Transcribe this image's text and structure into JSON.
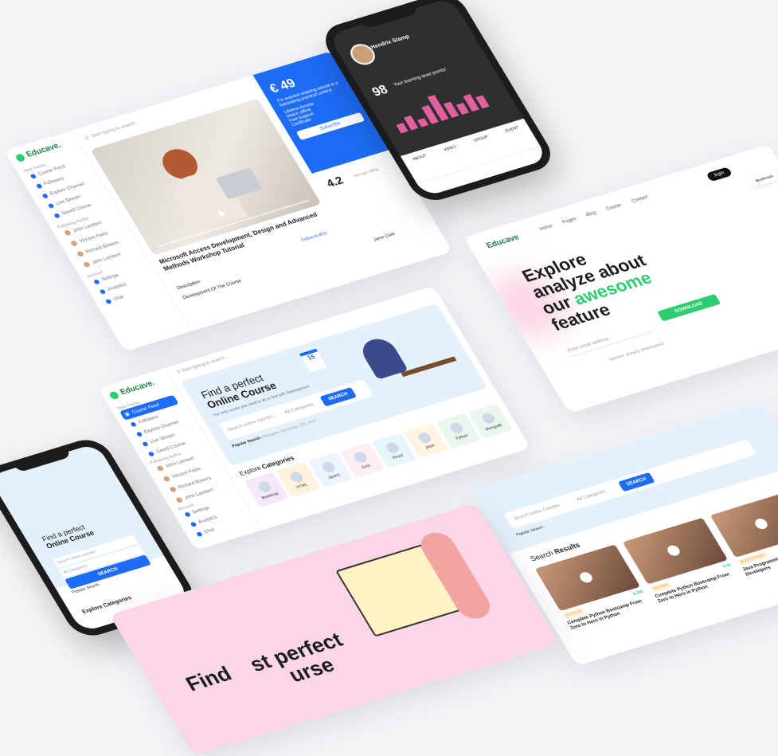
{
  "colors": {
    "accent": "#1d6cf5",
    "green": "#2ecc71",
    "pink": "#fbd6e6",
    "lightblue": "#e3f1fb",
    "dark": "#2b2b2b"
  },
  "course_page": {
    "brand": "Educave.",
    "search_placeholder": "Start typing to search...",
    "sidebar": {
      "section": "New Feeds",
      "items": [
        "Course Feed",
        "Followers",
        "Explore Channel",
        "Live Stream",
        "Saved Course"
      ],
      "following": "Following Author",
      "authors": [
        "John Lambert",
        "Vincent Parks",
        "Richard Bowers",
        "John Lambert"
      ],
      "account": "Account",
      "account_items": [
        "Settings",
        "Analytics",
        "Chat"
      ]
    },
    "price": "€ 49",
    "price_note": "For express ordering tutorial in a fascinating practical context",
    "features": [
      "Lifetime Access",
      "Watch offline",
      "Fast Support",
      "Certificate"
    ],
    "buy": "Subscribe",
    "course_title": "Microsoft Access Development, Design and Advanced Methods Workshop Tutorial",
    "rating": "4.2",
    "rating_label": "Average rating",
    "reviewer": "Jame Clark",
    "follow": "Follow Author",
    "tab_desc": "Description",
    "tab_more": "Development Of The Course"
  },
  "profile_phone": {
    "name": "Hendrix Stamp",
    "score": "98",
    "score_label": "Your learning level points!",
    "bars": [
      0.3,
      0.45,
      0.25,
      0.6,
      0.85,
      0.5,
      0.35,
      0.55,
      0.4
    ],
    "tabs": [
      "ABOUT",
      "VIDEO",
      "GROUP",
      "EVENT"
    ]
  },
  "main_page": {
    "brand": "Educave.",
    "search_placeholder": "Start typing to search...",
    "sidebar": {
      "section": "New Feeds",
      "items": [
        "Course Feed",
        "Followers",
        "Explore Channel",
        "Live Stream",
        "Saved Course"
      ],
      "following": "Following Author",
      "authors": [
        "John Lambert",
        "Vincent Parks",
        "Richard Bowers",
        "John Lambert"
      ],
      "account": "Account",
      "account_items": [
        "Settings",
        "Analytics",
        "Chat"
      ]
    },
    "hero_title_1": "Find a perfect",
    "hero_title_2": "Online Course",
    "hero_sub": "For only course you need to do to find with Development",
    "search_input": "Search online courses..",
    "category_select": "All Categories",
    "search_button": "SEARCH",
    "popular": "Popular Search :",
    "popular_items": "Designer, Developer, iOS, PHP",
    "explore_1": "Explore",
    "explore_2": "Categories",
    "categories": [
      {
        "name": "Bootstrap",
        "color": "#f3e9fb"
      },
      {
        "name": "HTML",
        "color": "#fff3e0"
      },
      {
        "name": "Jquery",
        "color": "#eef4ff"
      },
      {
        "name": "Sass",
        "color": "#ffeef3"
      },
      {
        "name": "React",
        "color": "#e6f7fb"
      },
      {
        "name": "JAVA",
        "color": "#fff5e0"
      },
      {
        "name": "Python",
        "color": "#eaf5ee"
      },
      {
        "name": "Mongodb",
        "color": "#eaf6ee"
      }
    ],
    "calendar_day": "15"
  },
  "landing": {
    "brand": "Educave",
    "nav": [
      "Home",
      "Pages",
      "Blog",
      "Course",
      "Contact"
    ],
    "login": "login",
    "headline_1": "Explore",
    "headline_2": "analyze about",
    "headline_3": "our",
    "headline_highlight": "awesome",
    "headline_4": "feature",
    "email_placeholder": "Enter email address",
    "download": "DOWNLOAD",
    "members": "Member already downloaded",
    "bookmark": "Bookmark"
  },
  "left_phone": {
    "title_1": "Find a perfect",
    "title_2": "Online Course",
    "search": "Search online courses..",
    "category": "All Categories",
    "button": "SEARCH",
    "popular": "Popular Search :",
    "explore": "Explore Categories"
  },
  "results": {
    "search": "Search online courses..",
    "popular": "Popular Search :",
    "category": "All Categories",
    "button": "SEARCH",
    "heading_1": "Search",
    "heading_2": "Results",
    "cards": [
      {
        "tag": "PYTHON",
        "price": "$ 240",
        "title": "Complete Python Bootcamp From Zero to Hero in Python"
      },
      {
        "tag": "DESIGN",
        "price": "$ 40",
        "title": "Complete Python Bootcamp From Zero to Hero in Python"
      },
      {
        "tag": "BOOTSTRAP",
        "price": "$ 60",
        "title": "Java Programming Masterclass for Developers"
      }
    ]
  },
  "pink_page": {
    "headline_left": "Find",
    "headline_right": "st perfect",
    "headline_bottom": "urse"
  }
}
